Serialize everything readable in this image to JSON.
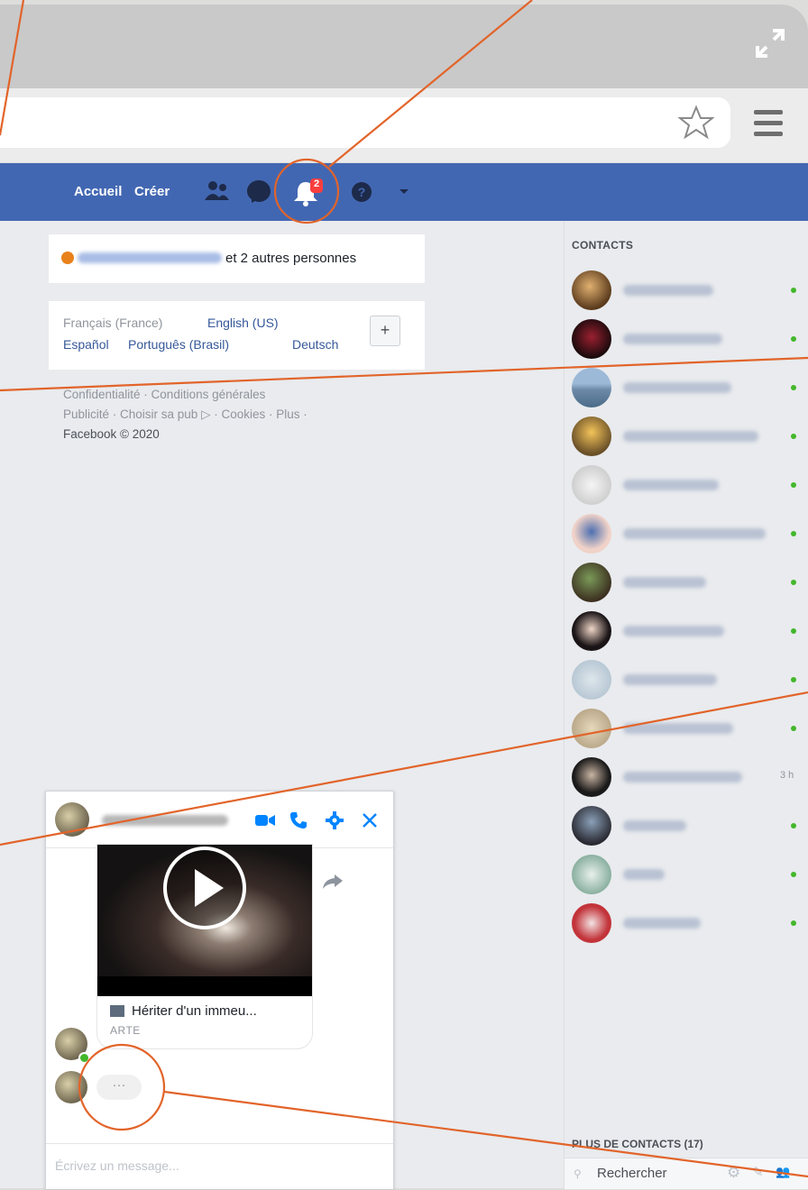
{
  "nav": {
    "home_label": "Accueil",
    "create_label": "Créer",
    "notification_count": "2"
  },
  "story": {
    "suffix": " et 2 autres personnes"
  },
  "languages": {
    "current": "Français (France)",
    "english": "English (US)",
    "spanish": "Español",
    "portuguese": "Português (Brasil)",
    "german": "Deutsch",
    "add_label": "+"
  },
  "footer": {
    "line1": "Confidentialité · Conditions générales",
    "line2": "Publicité · Choisir sa pub ▷ · Cookies · Plus ·",
    "copyright": "Facebook © 2020"
  },
  "contacts": {
    "title": "CONTACTS",
    "more_title": "PLUS DE CONTACTS (17)",
    "search_placeholder": "Rechercher",
    "items": [
      {
        "status": "online"
      },
      {
        "status": "online"
      },
      {
        "status": "online"
      },
      {
        "status": "online"
      },
      {
        "status": "online"
      },
      {
        "status": "online"
      },
      {
        "status": "online"
      },
      {
        "status": "online"
      },
      {
        "status": "online"
      },
      {
        "status": "online"
      },
      {
        "status": "away",
        "ago": "3 h"
      },
      {
        "status": "online"
      },
      {
        "status": "online"
      },
      {
        "status": "online"
      }
    ]
  },
  "chat": {
    "link_title": "Hériter d'un immeu...",
    "link_source": "ARTE",
    "typing_indicator": "···",
    "input_placeholder": "Écrivez un message..."
  },
  "colors": {
    "fb_blue": "#4267b2",
    "messenger_blue": "#0084ff",
    "online_green": "#42b72a",
    "notification_red": "#fa3e3e",
    "annotation_orange": "#e2642a"
  }
}
